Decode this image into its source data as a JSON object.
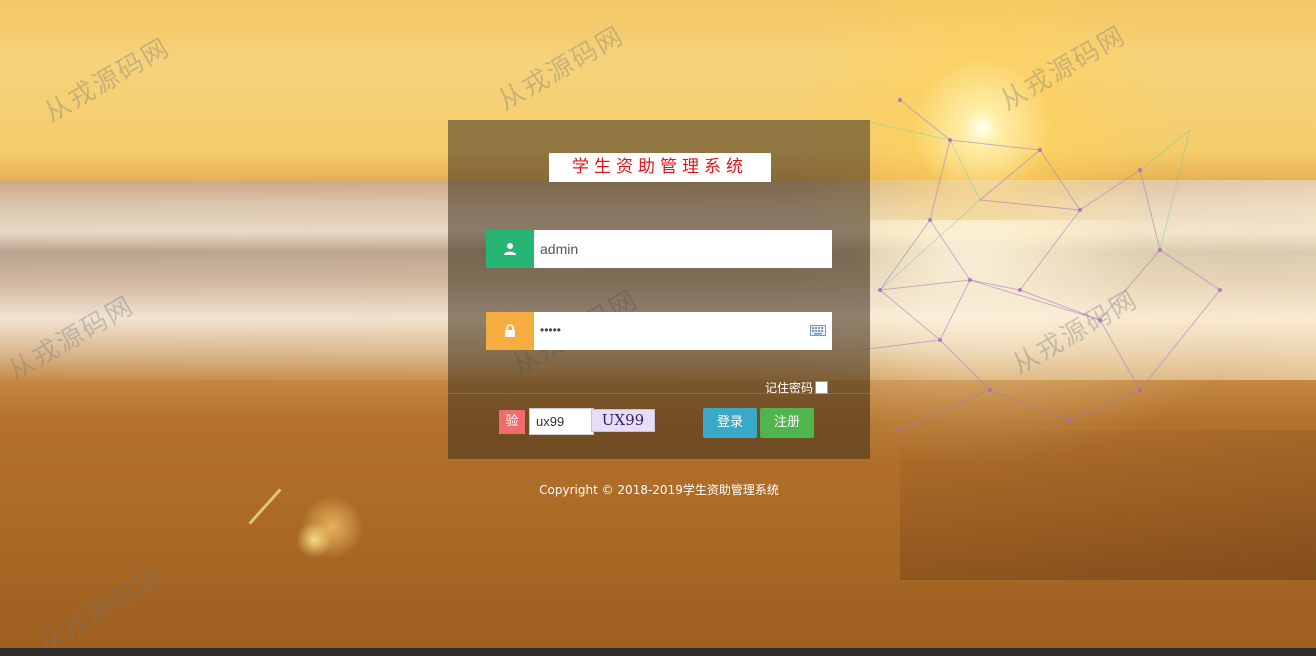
{
  "background": {
    "watermark_text": "从戎源码网"
  },
  "login": {
    "title": "学生资助管理系统",
    "username_value": "admin",
    "password_mask": "•••••",
    "remember_label": "记住密码",
    "captcha_tag": "验",
    "captcha_value": "ux99",
    "captcha_image_text": "UX99",
    "login_button": "登录",
    "register_button": "注册"
  },
  "footer": {
    "copyright": "Copyright © 2018-2019学生资助管理系统"
  },
  "colors": {
    "title_text": "#e4141b",
    "user_icon_bg": "#26b574",
    "pass_icon_bg": "#f4ad3e",
    "captcha_tag_bg": "#f06d6d",
    "login_button_bg": "#3aa9c9",
    "register_button_bg": "#51b54e"
  },
  "icons": {
    "user": "user-icon",
    "lock": "lock-icon",
    "keyboard": "keyboard-icon"
  }
}
